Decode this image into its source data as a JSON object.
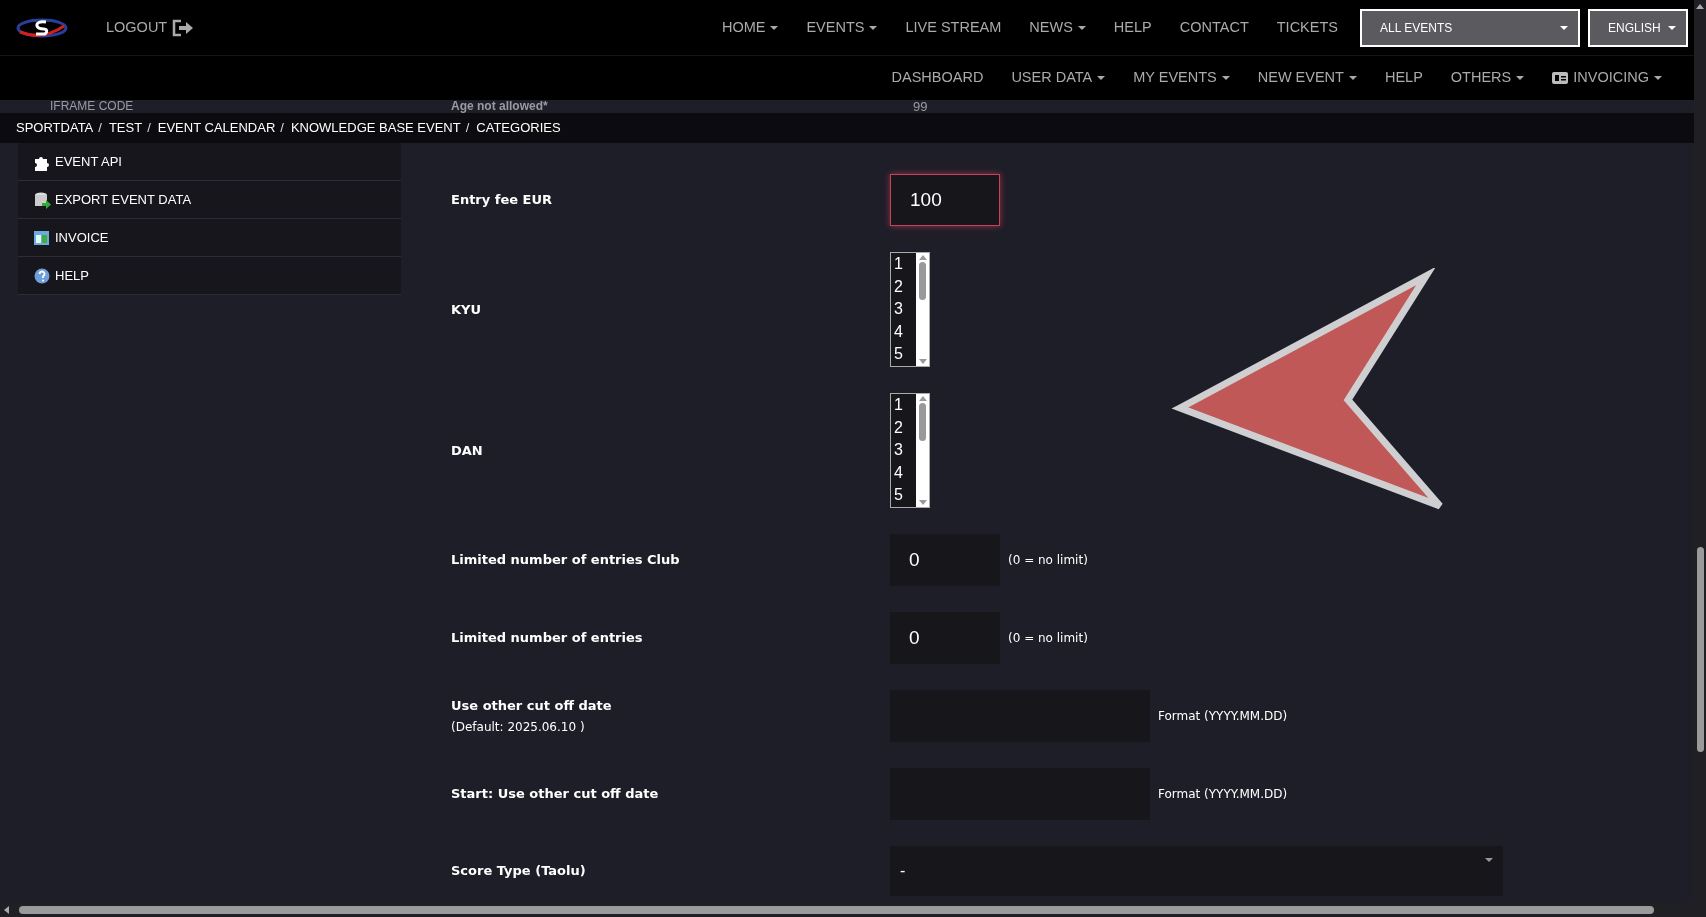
{
  "top_nav": {
    "logout": {
      "label": "LOGOUT"
    },
    "items": [
      {
        "label": "HOME",
        "dropdown": true
      },
      {
        "label": "EVENTS",
        "dropdown": true
      },
      {
        "label": "LIVE STREAM",
        "dropdown": false
      },
      {
        "label": "NEWS",
        "dropdown": true
      },
      {
        "label": "HELP",
        "dropdown": false
      },
      {
        "label": "CONTACT",
        "dropdown": false
      },
      {
        "label": "TICKETS",
        "dropdown": false
      }
    ],
    "event_select": {
      "value": "ALL EVENTS"
    },
    "language_select": {
      "value": "ENGLISH"
    }
  },
  "sub_nav": {
    "items": [
      {
        "label": "DASHBOARD",
        "dropdown": false,
        "kind": "text"
      },
      {
        "label": "USER DATA",
        "dropdown": true,
        "kind": "text"
      },
      {
        "label": "MY EVENTS",
        "dropdown": true,
        "kind": "text"
      },
      {
        "label": "NEW EVENT",
        "dropdown": true,
        "kind": "text"
      },
      {
        "label": "HELP",
        "dropdown": false,
        "kind": "text"
      },
      {
        "label": "OTHERS",
        "dropdown": true,
        "kind": "text"
      },
      {
        "label": "INVOICING",
        "dropdown": true,
        "kind": "card-icon"
      }
    ]
  },
  "breadcrumb": [
    {
      "label": "SPORTDATA",
      "separator": "/"
    },
    {
      "label": "TEST",
      "separator": "/"
    },
    {
      "label": "EVENT CALENDAR",
      "separator": "/"
    },
    {
      "label": "KNOWLEDGE BASE EVENT",
      "separator": "/"
    },
    {
      "label": "CATEGORIES"
    }
  ],
  "covered_row": {
    "sidebar_item": "IFRAME CODE",
    "field_label": "Age not allowed*",
    "field_value": "99"
  },
  "sidebar": {
    "items": [
      {
        "label": "EVENT API",
        "kind": "puzzle"
      },
      {
        "label": "EXPORT EVENT DATA",
        "kind": "export"
      },
      {
        "label": "INVOICE",
        "kind": "table"
      },
      {
        "label": "HELP",
        "kind": "help"
      }
    ]
  },
  "form": {
    "rows": [
      {
        "kind": "number",
        "label": "Entry fee EUR",
        "value": "100",
        "focused": true
      },
      {
        "kind": "multiselect",
        "label": "KYU",
        "options": [
          "1",
          "2",
          "3",
          "4",
          "5"
        ]
      },
      {
        "kind": "multiselect",
        "label": "DAN",
        "options": [
          "1",
          "2",
          "3",
          "4",
          "5"
        ]
      },
      {
        "kind": "number",
        "label": "Limited number of entries Club",
        "value": "0",
        "focused": false,
        "hint": "(0 = no limit)"
      },
      {
        "kind": "number",
        "label": "Limited number of entries",
        "value": "0",
        "focused": false,
        "hint": "(0 = no limit)"
      },
      {
        "kind": "date",
        "label": "Use other cut off date",
        "note": "(Default: 2025.06.10 )",
        "hint": "Format (YYYY.MM.DD)"
      },
      {
        "kind": "date",
        "label": "Start: Use other cut off date",
        "hint": "Format (YYYY.MM.DD)"
      },
      {
        "kind": "select",
        "label": "Score Type (Taolu)",
        "value": "-"
      }
    ]
  }
}
